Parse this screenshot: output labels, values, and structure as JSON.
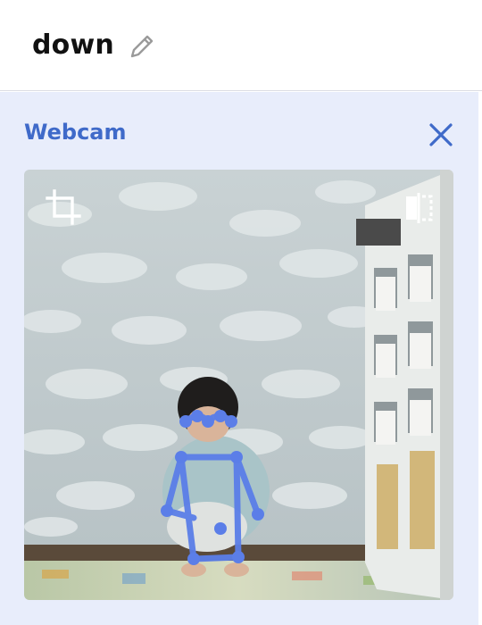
{
  "header": {
    "class_name": "down",
    "edit_icon": "pencil-icon"
  },
  "webcam_panel": {
    "title": "Webcam",
    "close_icon": "close-x-icon",
    "feed": {
      "crop_icon": "crop-icon",
      "flip_icon": "flip-horizontal-icon",
      "pose_overlay_color": "#5b7ee8"
    }
  },
  "colors": {
    "accent": "#3f6ac9",
    "panel_background": "#e8edfb",
    "pose_keypoints": "#5b7ee8"
  }
}
